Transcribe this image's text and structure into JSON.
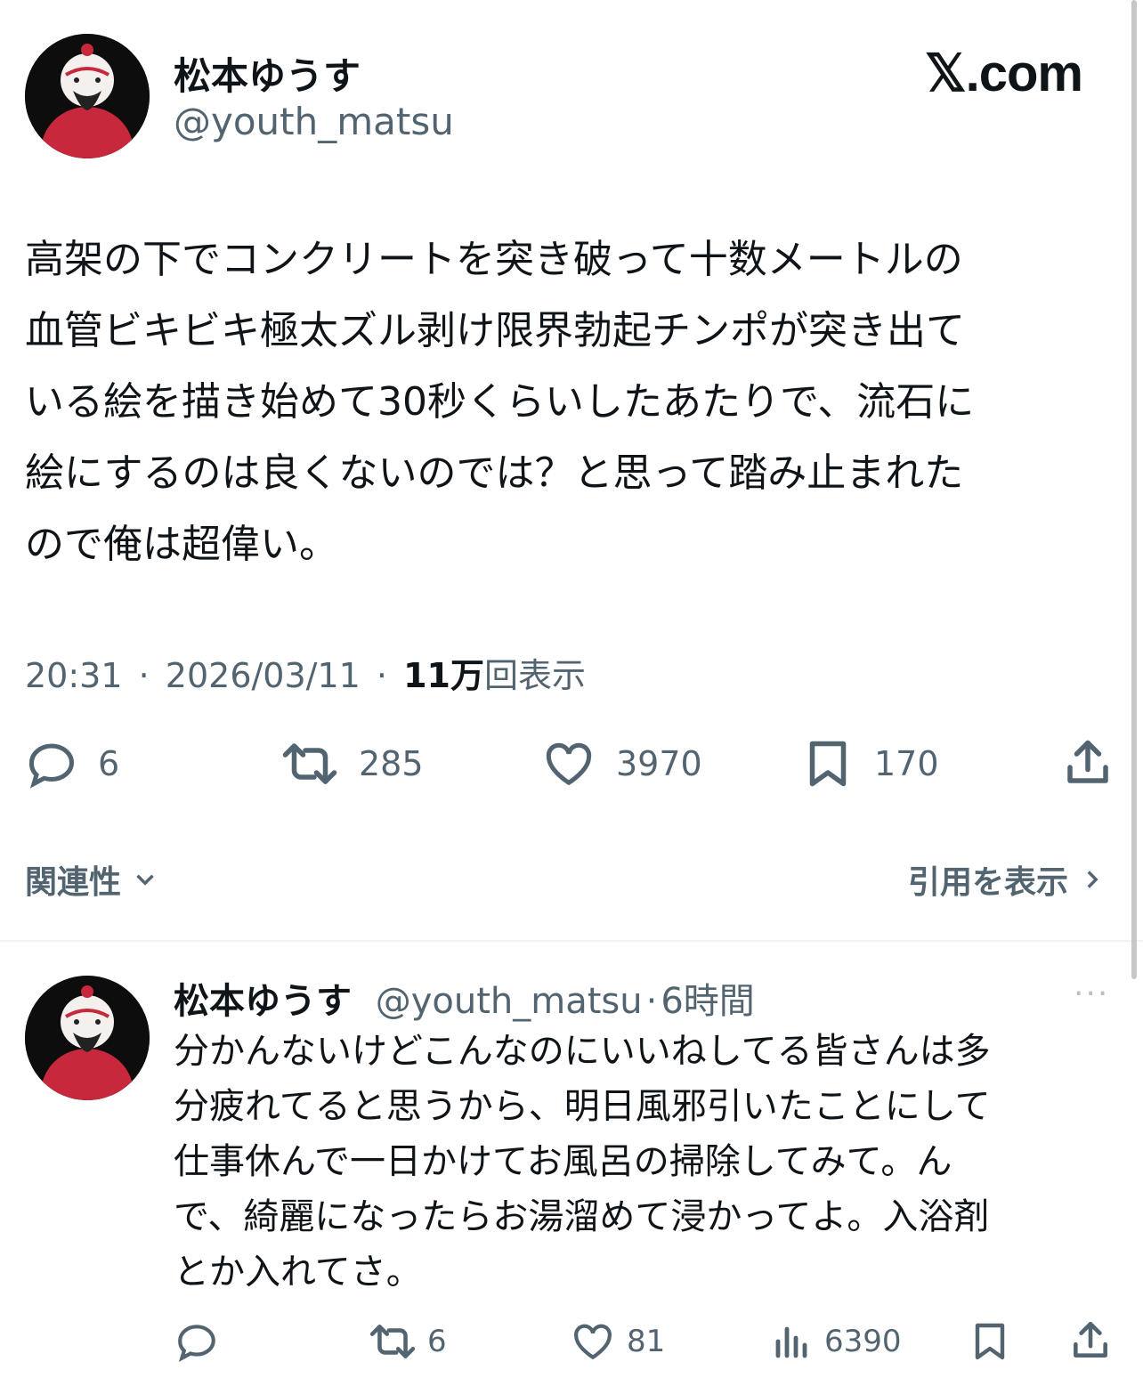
{
  "brand": "𝕏.com",
  "main_tweet": {
    "display_name": "松本ゆうす",
    "handle": "@youth_matsu",
    "text": "高架の下でコンクリートを突き破って十数メートルの\n血管ビキビキ極太ズル剥け限界勃起チンポが突き出て\nいる絵を描き始めて30秒くらいしたあたりで、流石に\n絵にするのは良くないのでは？と思って踏み止まれた\nので俺は超偉い。",
    "time": "20:31",
    "date": "2026/03/11",
    "views_count": "11万",
    "views_label": "回表示",
    "separator": "·",
    "actions": {
      "replies": "6",
      "reposts": "285",
      "likes": "3970",
      "bookmarks": "170"
    },
    "related_label": "関連性",
    "quotes_label": "引用を表示"
  },
  "reply_tweet": {
    "display_name": "松本ゆうす",
    "handle": "@youth_matsu",
    "separator": "·",
    "age": "6時間",
    "more": "···",
    "text": "分かんないけどこんなのにいいねしてる皆さんは多\n分疲れてると思うから、明日風邪引いたことにして\n仕事休んで一日かけてお風呂の掃除してみて。ん\nで、綺麗になったらお湯溜めて浸かってよ。入浴剤\nとか入れてさ。",
    "actions": {
      "reposts": "6",
      "likes": "81",
      "views": "6390"
    }
  },
  "colors": {
    "text": "#0f1419",
    "secondary": "#536471",
    "avatar_bg": "#0d0d0d",
    "avatar_body": "#c8283c"
  }
}
